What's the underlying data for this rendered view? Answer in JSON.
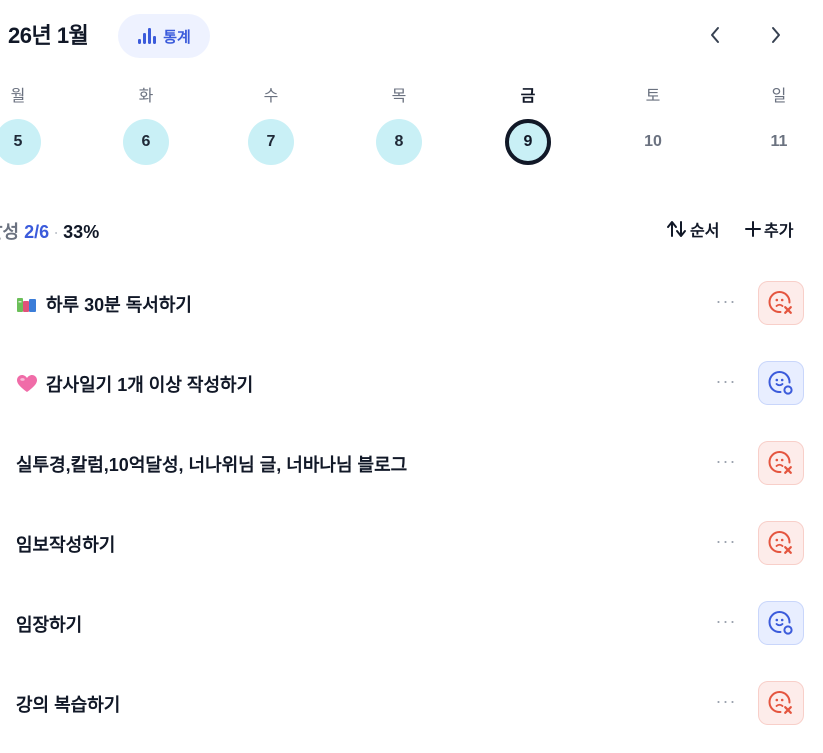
{
  "header": {
    "month_title": "26년 1월",
    "stats_label": "통계",
    "prev_icon": "chevron-left-icon",
    "next_icon": "chevron-right-icon"
  },
  "week": [
    {
      "weekday": "월",
      "date": "5",
      "state": "done"
    },
    {
      "weekday": "화",
      "date": "6",
      "state": "done"
    },
    {
      "weekday": "수",
      "date": "7",
      "state": "done"
    },
    {
      "weekday": "목",
      "date": "8",
      "state": "done"
    },
    {
      "weekday": "금",
      "date": "9",
      "state": "today"
    },
    {
      "weekday": "토",
      "date": "10",
      "state": "plain"
    },
    {
      "weekday": "일",
      "date": "11",
      "state": "plain"
    }
  ],
  "summary": {
    "label": "달성",
    "ratio": "2/6",
    "separator": "·",
    "percent": "33%"
  },
  "actions": {
    "sort_label": "순서",
    "add_label": "추가"
  },
  "habits": [
    {
      "icon": "books-icon",
      "title": "하루 30분 독서하기",
      "status": "fail"
    },
    {
      "icon": "heart-icon",
      "title": "감사일기 1개 이상 작성하기",
      "status": "ok"
    },
    {
      "icon": "",
      "title": "실투경,칼럼,10억달성, 너나위님 글, 너바나님 블로그",
      "status": "fail"
    },
    {
      "icon": "",
      "title": "임보작성하기",
      "status": "fail"
    },
    {
      "icon": "",
      "title": "임장하기",
      "status": "ok"
    },
    {
      "icon": "",
      "title": "강의 복습하기",
      "status": "fail"
    }
  ],
  "more_label": "···",
  "colors": {
    "accent": "#3b5bdb",
    "done_day": "#c9f0f6",
    "fail": "#e4553f",
    "ok": "#3b5bdb"
  }
}
